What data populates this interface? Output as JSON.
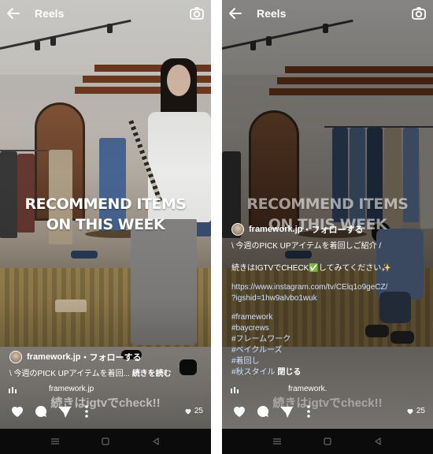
{
  "screens": [
    {
      "header": {
        "title": "Reels"
      },
      "headline": {
        "line1": "RECOMMEND ITEMS",
        "line2": "ON THIS WEEK"
      },
      "user": {
        "name": "framework.jp",
        "separator": "・",
        "follow": "フォローする"
      },
      "caption": {
        "text": "\\ 今週のPICK UPアイテムを着回... ",
        "more": "続きを読む"
      },
      "igtv_label": "framework.jp",
      "bottom_caption": "続きはigtvでcheck!!",
      "likes": "25",
      "icons": [
        "back-arrow-icon",
        "camera-icon",
        "heart-icon",
        "comment-icon",
        "share-icon",
        "more-icon",
        "volume-icon"
      ]
    },
    {
      "header": {
        "title": "Reels"
      },
      "headline": {
        "line1": "RECOMMEND ITEMS",
        "line2": "ON THIS WEEK"
      },
      "user": {
        "name": "framework.jp",
        "separator": "・",
        "follow": "フォローする"
      },
      "caption": {
        "line1": "\\ 今週のPICK UPアイテムを着回しご紹介 /",
        "line2": "続きはIGTVでCHECK✅してみてください✨",
        "url1": "https://www.instagram.com/tv/CElq1o9geCZ/",
        "url2": "?igshid=1hw9alvbo1wuk",
        "hashtags": [
          "#framework",
          "#baycrews",
          "#フレームワーク",
          "#ベイクルーズ",
          "#着回し"
        ],
        "last_tag": "#秋スタイル",
        "close": "閉じる"
      },
      "igtv_label": "framework.",
      "bottom_caption": "続きはigtvでcheck!!",
      "likes": "25",
      "icons": [
        "back-arrow-icon",
        "camera-icon",
        "heart-icon",
        "comment-icon",
        "share-icon",
        "more-icon",
        "volume-icon"
      ]
    }
  ],
  "colors": {
    "nav_bar": "#0b0b0b",
    "hashtag": "#cfe0ff",
    "background": "#ffffff"
  }
}
